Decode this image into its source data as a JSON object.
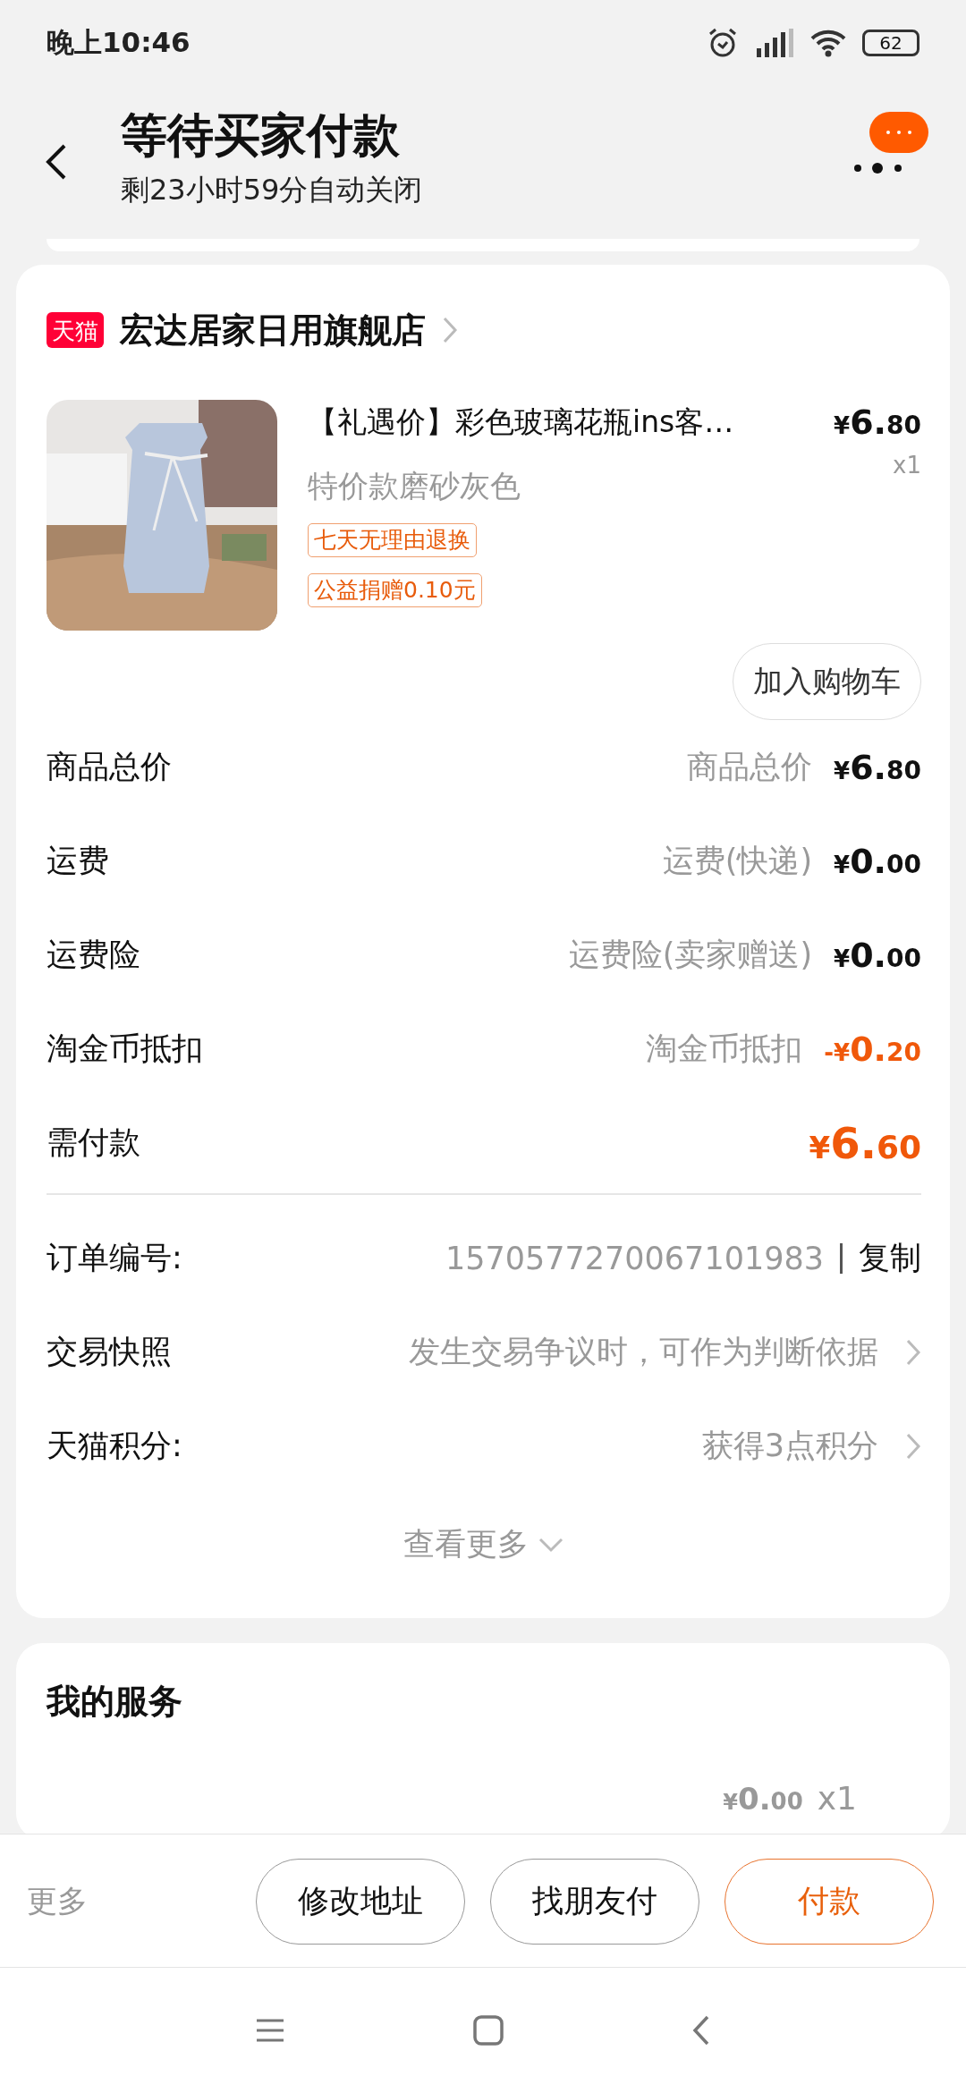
{
  "status_bar": {
    "time": "晚上10:46",
    "battery": "62"
  },
  "header": {
    "title": "等待买家付款",
    "subtitle": "剩23小时59分自动关闭"
  },
  "store": {
    "badge": "天猫",
    "name": "宏达居家日用旗舰店"
  },
  "product": {
    "title": "【礼遇价】彩色玻璃花瓶ins客…",
    "price": "¥6.80",
    "quantity": "x1",
    "variant": "特价款磨砂灰色",
    "tags": [
      "七天无理由退换",
      "公益捐赠0.10元"
    ],
    "button": "加入购物车"
  },
  "fees": [
    {
      "label": "商品总价",
      "note": "商品总价",
      "amount": "¥6.80",
      "kind": "normal"
    },
    {
      "label": "运费",
      "note": "运费(快递)",
      "amount": "¥0.00",
      "kind": "normal"
    },
    {
      "label": "运费险",
      "note": "运费险(卖家赠送)",
      "amount": "¥0.00",
      "kind": "normal"
    },
    {
      "label": "淘金币抵扣",
      "note": "淘金币抵扣",
      "amount": "-¥0.20",
      "kind": "discount"
    },
    {
      "label": "需付款",
      "amount": "¥6.60",
      "kind": "total"
    }
  ],
  "info": [
    {
      "label": "订单编号:",
      "value": "1570577270067101983",
      "action": "复制",
      "kind": "copy"
    },
    {
      "label": "交易快照",
      "value": "发生交易争议时，可作为判断依据",
      "kind": "link"
    },
    {
      "label": "天猫积分:",
      "value": "获得3点积分",
      "kind": "link"
    }
  ],
  "more": "查看更多",
  "services": {
    "title": "我的服务",
    "items": [
      {
        "amount": "¥0.00",
        "quantity": "x1"
      }
    ]
  },
  "action_bar": {
    "more": "更多",
    "buttons": [
      {
        "label": "修改地址",
        "kind": "secondary"
      },
      {
        "label": "找朋友付",
        "kind": "secondary"
      },
      {
        "label": "付款",
        "kind": "primary"
      }
    ]
  }
}
